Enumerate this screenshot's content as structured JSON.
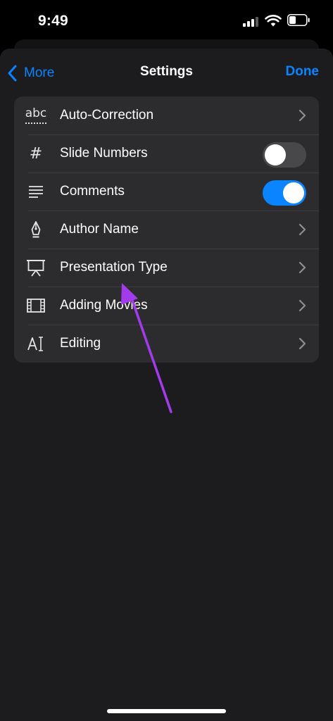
{
  "status_bar": {
    "time": "9:49",
    "icons": [
      "cellular-signal-icon",
      "wifi-icon",
      "battery-icon"
    ]
  },
  "nav": {
    "back_label": "More",
    "title": "Settings",
    "done_label": "Done"
  },
  "settings": [
    {
      "label": "Auto-Correction",
      "icon": "abc-icon",
      "accessory": "chevron"
    },
    {
      "label": "Slide Numbers",
      "icon": "hash-icon",
      "accessory": "toggle",
      "on": false
    },
    {
      "label": "Comments",
      "icon": "comments-icon",
      "accessory": "toggle",
      "on": true
    },
    {
      "label": "Author Name",
      "icon": "pen-nib-icon",
      "accessory": "chevron"
    },
    {
      "label": "Presentation Type",
      "icon": "presentation-easel-icon",
      "accessory": "chevron"
    },
    {
      "label": "Adding Movies",
      "icon": "film-icon",
      "accessory": "chevron"
    },
    {
      "label": "Editing",
      "icon": "text-cursor-icon",
      "accessory": "chevron"
    }
  ],
  "colors": {
    "accent": "#0a84ff",
    "background": "#1c1c1e",
    "group_background": "#2c2c2e",
    "toggle_off": "#48484a",
    "annotation_arrow": "#a23bea"
  }
}
